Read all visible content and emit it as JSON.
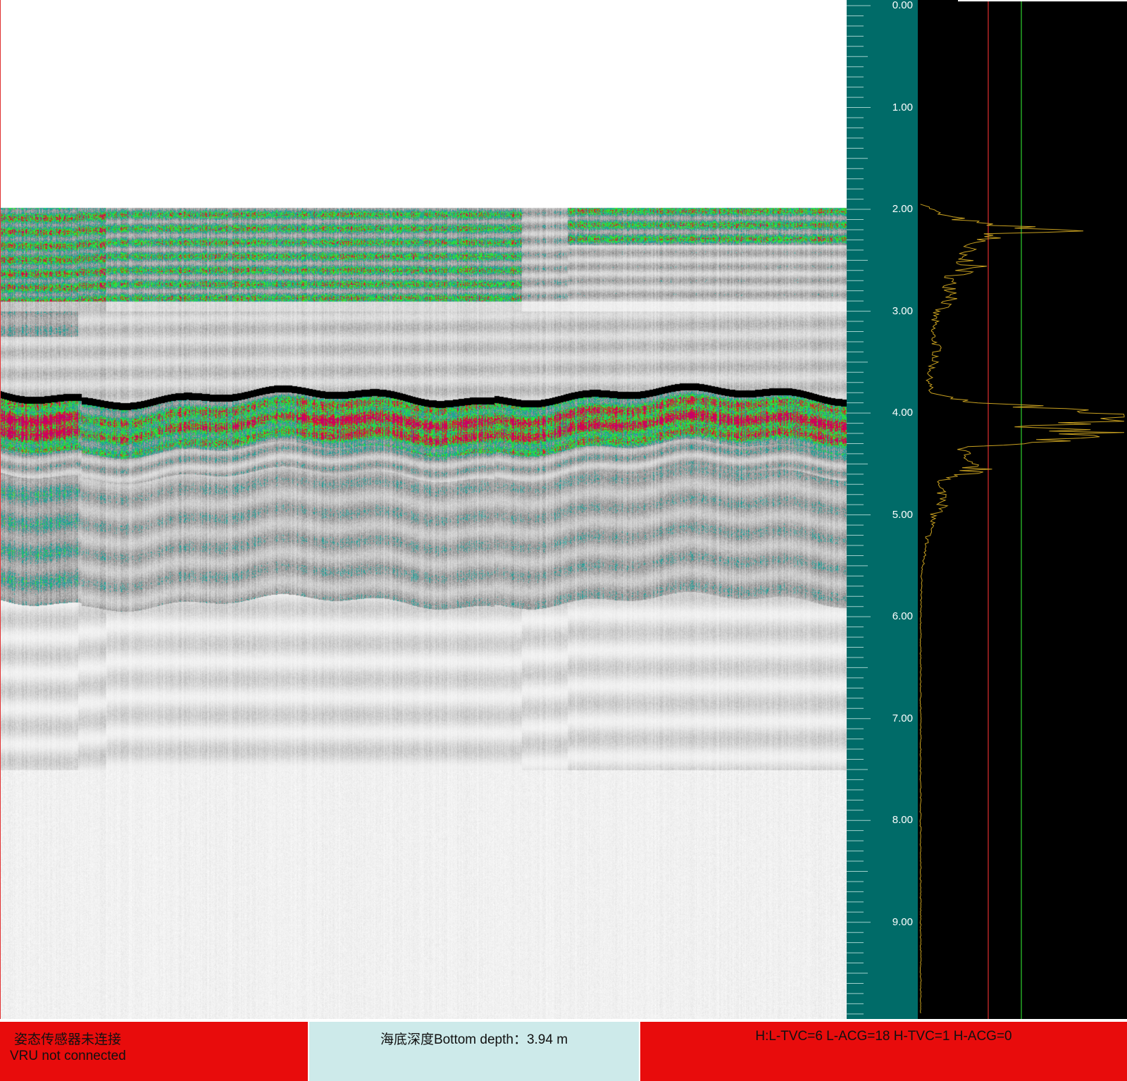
{
  "echogram": {
    "bottom_depth_m": 3.94,
    "display_range_m": [
      0,
      10
    ],
    "palette": {
      "background": "#ffffff",
      "weak": "#b8b8b8",
      "low": "#1aa39b",
      "mid": "#2ee82e",
      "high": "#e81818",
      "max": "#c4006a",
      "bottom_line": "#000000"
    }
  },
  "depth_scale": {
    "background": "#006b68",
    "labels": [
      "0.00",
      "1.00",
      "2.00",
      "3.00",
      "4.00",
      "5.00",
      "6.00",
      "7.00",
      "8.00",
      "9.00"
    ],
    "range_m": [
      0,
      10
    ]
  },
  "waveform": {
    "background": "#000000",
    "trace_color": "#c8a020",
    "threshold_colors": [
      "#e03030",
      "#30d030"
    ],
    "profile": [
      [
        1.95,
        0.02
      ],
      [
        2.05,
        0.1
      ],
      [
        2.15,
        0.3
      ],
      [
        2.2,
        0.72
      ],
      [
        2.25,
        0.35
      ],
      [
        2.35,
        0.25
      ],
      [
        2.45,
        0.18
      ],
      [
        2.55,
        0.26
      ],
      [
        2.7,
        0.14
      ],
      [
        2.85,
        0.18
      ],
      [
        3.0,
        0.08
      ],
      [
        3.2,
        0.06
      ],
      [
        3.4,
        0.09
      ],
      [
        3.6,
        0.05
      ],
      [
        3.8,
        0.05
      ],
      [
        3.88,
        0.2
      ],
      [
        3.94,
        0.55
      ],
      [
        4.0,
        0.78
      ],
      [
        4.05,
        0.95
      ],
      [
        4.12,
        0.62
      ],
      [
        4.2,
        0.86
      ],
      [
        4.28,
        0.55
      ],
      [
        4.35,
        0.22
      ],
      [
        4.45,
        0.18
      ],
      [
        4.55,
        0.28
      ],
      [
        4.7,
        0.08
      ],
      [
        4.85,
        0.14
      ],
      [
        5.0,
        0.07
      ],
      [
        5.3,
        0.03
      ],
      [
        5.6,
        0.01
      ],
      [
        6.0,
        0.005
      ],
      [
        9.9,
        0.005
      ]
    ]
  },
  "status": {
    "vru": {
      "text_cn": "姿态传感器未连接",
      "text_en": "VRU not connected",
      "color": "#e80c0c"
    },
    "depth": {
      "text": "海底深度Bottom depth：3.94 m",
      "color": "#cdeaea"
    },
    "gain": {
      "text": "H:L-TVC=6 L-ACG=18 H-TVC=1 H-ACG=0",
      "color": "#e80c0c"
    }
  }
}
